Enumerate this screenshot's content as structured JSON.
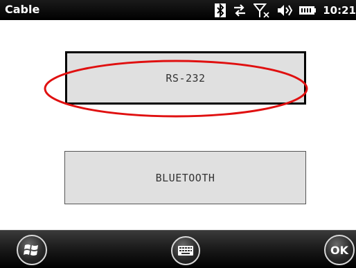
{
  "app": {
    "title": "Cable"
  },
  "status_bar": {
    "time": "10:21",
    "icons": [
      "bluetooth-icon",
      "data-sync-icon",
      "no-signal-icon",
      "volume-icon",
      "battery-icon"
    ]
  },
  "buttons": {
    "rs232_label": "RS-232",
    "bluetooth_label": "BLUETOOTH"
  },
  "highlight": {
    "color": "#e01010",
    "target": "RS-232"
  },
  "softkeys": {
    "start_icon": "windows-start-icon",
    "keyboard_icon": "keyboard-icon",
    "ok_label": "OK"
  }
}
